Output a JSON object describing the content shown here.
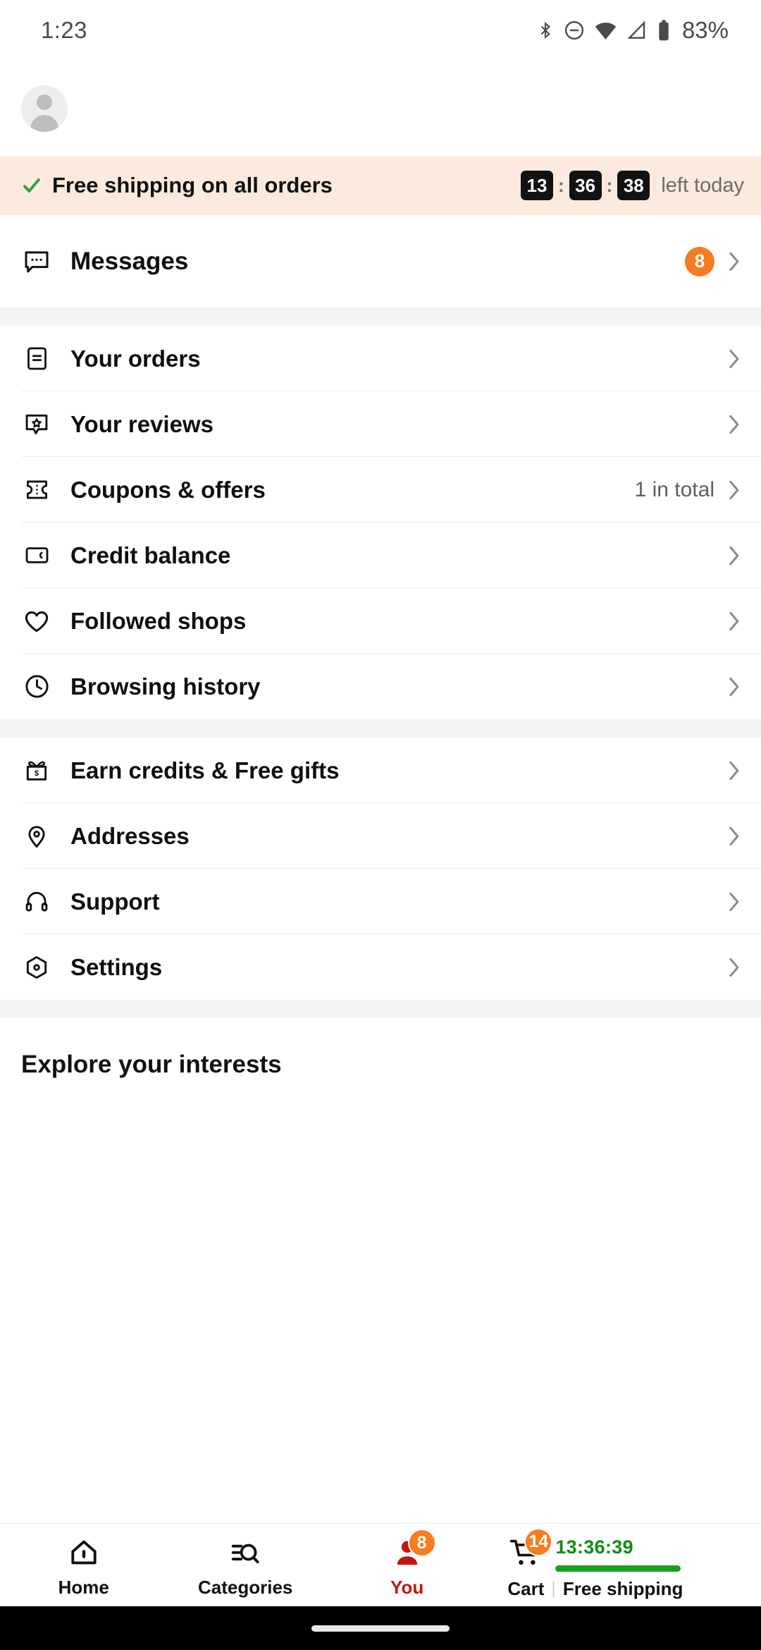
{
  "status_bar": {
    "time": "1:23",
    "battery_percent": "83%",
    "icons": [
      "bluetooth-icon",
      "do-not-disturb-icon",
      "wifi-icon",
      "cellular-signal-icon",
      "battery-icon"
    ]
  },
  "header": {
    "avatar_name": "avatar"
  },
  "shipping_banner": {
    "text": "Free shipping on all orders",
    "check_icon": "check-icon",
    "countdown": {
      "hours": "13",
      "minutes": "36",
      "seconds": "38",
      "separator": ":"
    },
    "countdown_label": "left today",
    "background_color": "#FBEADD",
    "check_color": "#24A148"
  },
  "messages_section": {
    "label": "Messages",
    "icon": "message-bubble-icon",
    "badge": "8",
    "badge_color": "#F57C1F"
  },
  "account_section": [
    {
      "label": "Your orders",
      "icon": "receipt-icon",
      "value": ""
    },
    {
      "label": "Your reviews",
      "icon": "review-star-bubble-icon",
      "value": ""
    },
    {
      "label": "Coupons & offers",
      "icon": "coupon-ticket-icon",
      "value": "1 in total"
    },
    {
      "label": "Credit balance",
      "icon": "wallet-card-icon",
      "value": ""
    },
    {
      "label": "Followed shops",
      "icon": "heart-icon",
      "value": ""
    },
    {
      "label": "Browsing history",
      "icon": "clock-icon",
      "value": ""
    }
  ],
  "tools_section": [
    {
      "label": "Earn credits & Free gifts",
      "icon": "gift-dollar-icon",
      "value": ""
    },
    {
      "label": "Addresses",
      "icon": "location-pin-icon",
      "value": ""
    },
    {
      "label": "Support",
      "icon": "headphones-icon",
      "value": ""
    },
    {
      "label": "Settings",
      "icon": "settings-hexagon-icon",
      "value": ""
    }
  ],
  "explore": {
    "title": "Explore your interests"
  },
  "bottom_nav": {
    "items": [
      {
        "label": "Home",
        "icon": "home-icon",
        "badge": "",
        "active": false
      },
      {
        "label": "Categories",
        "icon": "categories-search-icon",
        "badge": "",
        "active": false
      },
      {
        "label": "You",
        "icon": "person-icon",
        "badge": "8",
        "active": true
      }
    ],
    "cart": {
      "label": "Cart",
      "icon": "shopping-cart-icon",
      "badge": "14",
      "timer": "13:36:39",
      "separator": "|",
      "promo_label": "Free shipping",
      "timer_color": "#118C11",
      "bar_color": "#1AA01A"
    },
    "active_color": "#C2170F"
  }
}
